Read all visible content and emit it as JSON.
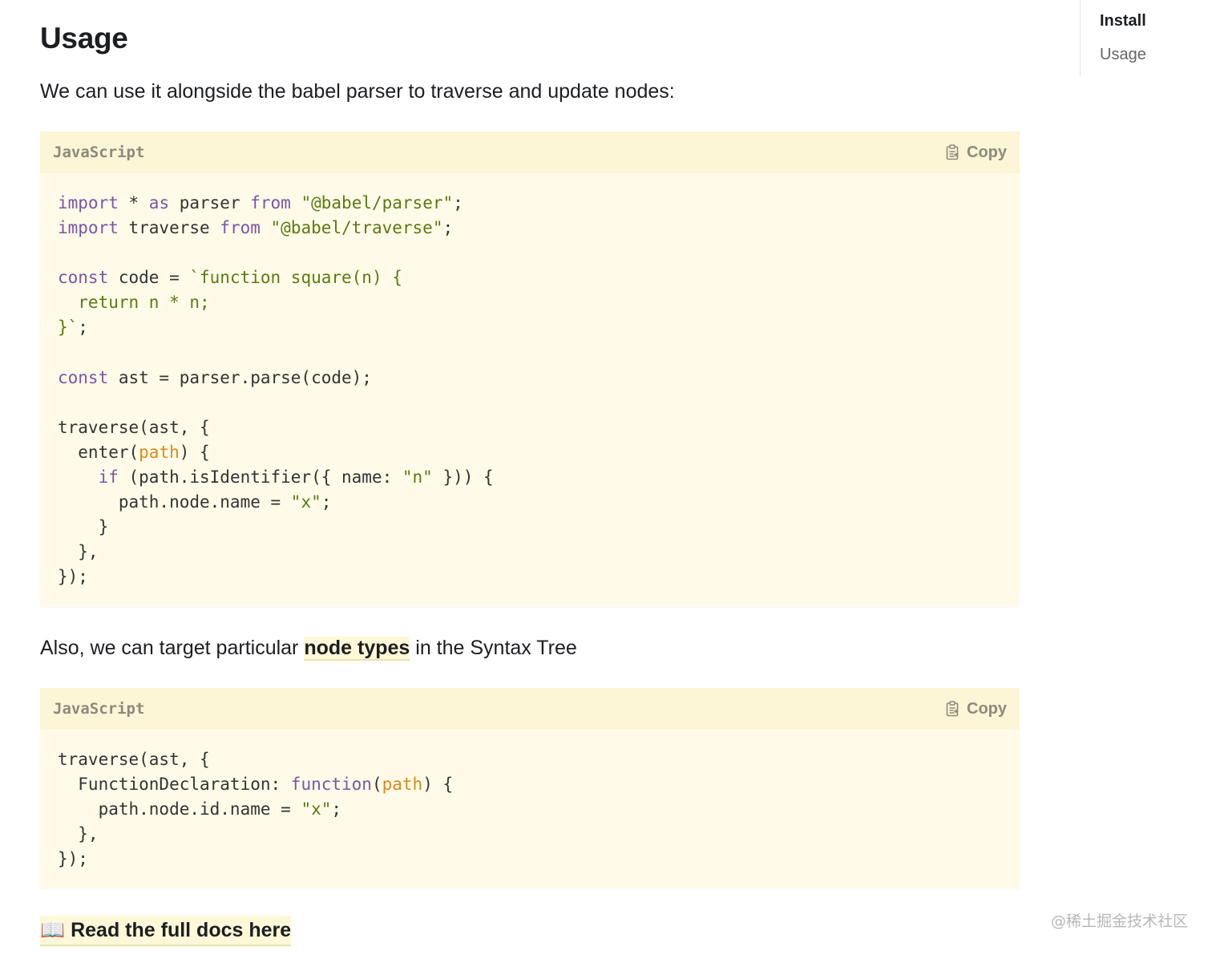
{
  "heading": "Usage",
  "intro": "We can use it alongside the babel parser to traverse and update nodes:",
  "code_blocks": [
    {
      "language": "JavaScript",
      "copy_label": "Copy",
      "code": "import * as parser from \"@babel/parser\";\nimport traverse from \"@babel/traverse\";\n\nconst code = `function square(n) {\n  return n * n;\n}`;\n\nconst ast = parser.parse(code);\n\ntraverse(ast, {\n  enter(path) {\n    if (path.isIdentifier({ name: \"n\" })) {\n      path.node.name = \"x\";\n    }\n  },\n});"
    },
    {
      "language": "JavaScript",
      "copy_label": "Copy",
      "code": "traverse(ast, {\n  FunctionDeclaration: function(path) {\n    path.node.id.name = \"x\";\n  },\n});"
    }
  ],
  "also": {
    "before": "Also, we can target particular ",
    "link": "node types",
    "after": " in the Syntax Tree"
  },
  "docs_link": {
    "emoji": "📖",
    "text": "Read the full docs here"
  },
  "toc": {
    "items": [
      {
        "label": "Install",
        "active": true
      },
      {
        "label": "Usage",
        "active": false
      }
    ]
  },
  "watermark": "@稀土掘金技术社区",
  "colors": {
    "code_bg": "#fffbe8",
    "code_header_bg": "#fcf5d6",
    "keyword": "#7a55a8",
    "string": "#5a7a12",
    "param": "#d98a1c"
  },
  "icons": {
    "copy": "clipboard-icon",
    "docs": "open-book-icon"
  }
}
